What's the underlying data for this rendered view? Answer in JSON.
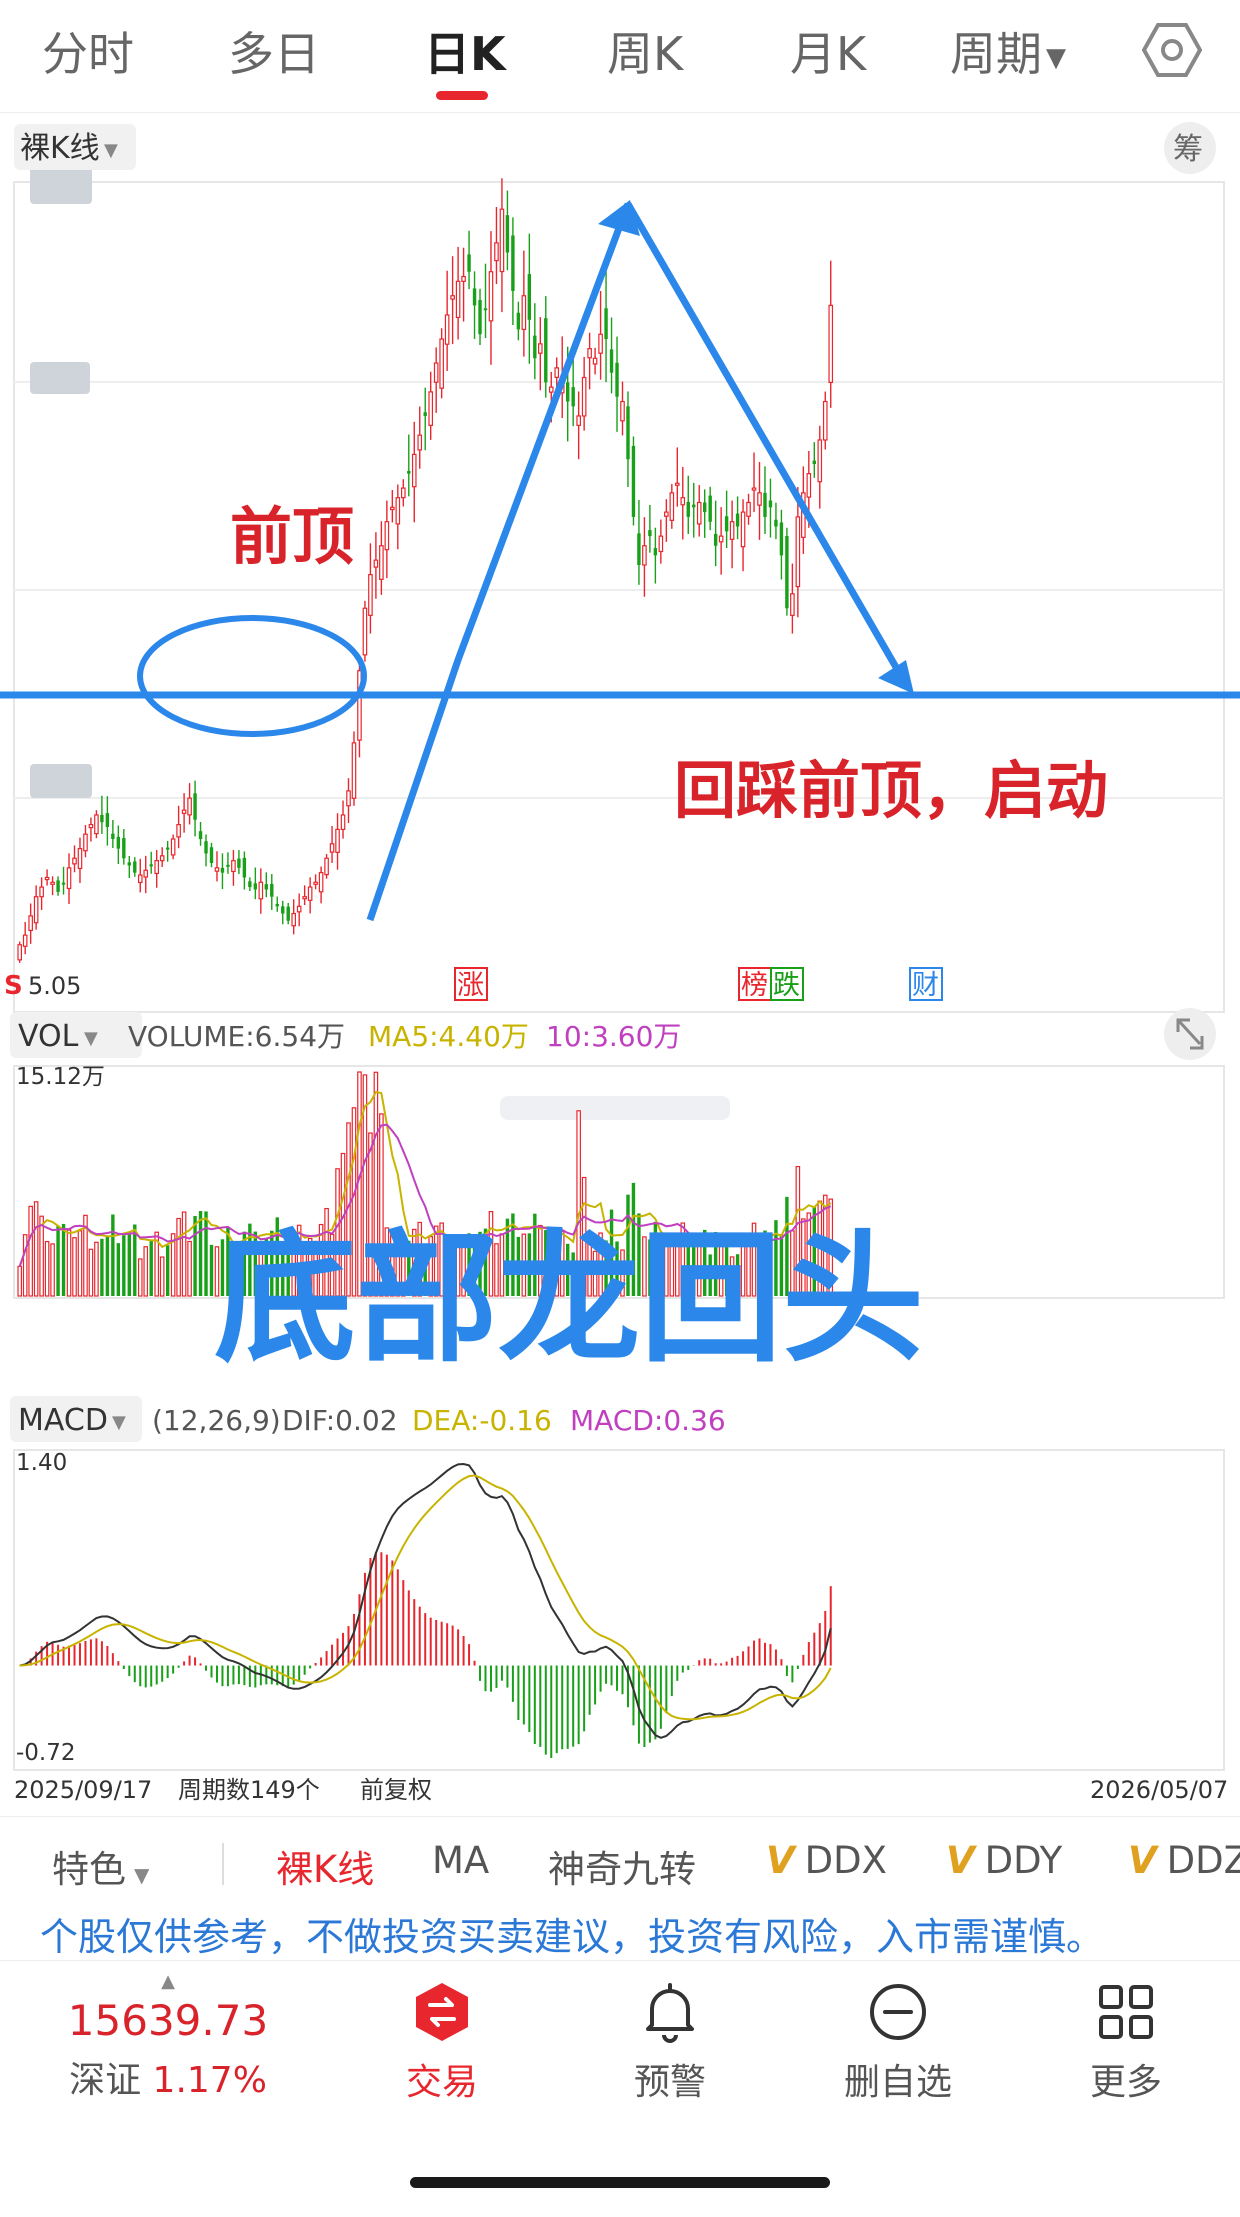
{
  "tabs": [
    "分时",
    "多日",
    "日K",
    "周K",
    "月K",
    "周期"
  ],
  "active_tab": "日K",
  "colors": {
    "up": "#e8262d",
    "down": "#18a018",
    "annotation": "#2b88ea",
    "ma5": "#c8b400",
    "ma10": "#c040c0",
    "dea": "#c8b400",
    "dif": "#333333"
  },
  "kline": {
    "type_label": "裸K线",
    "chip_label": "筹",
    "low_label": "5.05",
    "s_mark": "S",
    "markers": [
      "涨",
      "榜",
      "跌",
      "财"
    ]
  },
  "volume": {
    "indicator": "VOL",
    "volume_text": "VOLUME:6.54万",
    "ma5_text": "MA5:4.40万",
    "ma10_text": "10:3.60万",
    "max_label": "15.12万"
  },
  "macd": {
    "indicator": "MACD",
    "params": "(12,26,9)",
    "dif_text": "DIF:0.02",
    "dea_text": "DEA:-0.16",
    "macd_text": "MACD:0.36",
    "max_label": "1.40",
    "min_label": "-0.72"
  },
  "footer_axis": {
    "start_date": "2025/09/17",
    "period_count": "周期数149个",
    "adjust": "前复权",
    "end_date": "2026/05/07"
  },
  "annotations": {
    "prev_top": "前顶",
    "retest": "回踩前顶，启动",
    "pattern": "底部龙回头"
  },
  "features": [
    "特色",
    "裸K线",
    "MA",
    "神奇九转",
    "DDX",
    "DDY",
    "DDZ"
  ],
  "disclaimer": "个股仅供参考，不做投资买卖建议，投资有风险，入市需谨慎。",
  "index": {
    "value": "15639.73",
    "name": "深证",
    "change": "1.17%"
  },
  "nav": [
    "交易",
    "预警",
    "删自选",
    "更多"
  ],
  "chart_data": {
    "type": "candlestick",
    "count": 149,
    "x_start": "2025/09/17",
    "x_end": "2026/05/07",
    "low_label": 5.05,
    "close": [
      5.3,
      5.5,
      5.9,
      6.3,
      6.5,
      6.7,
      6.6,
      6.4,
      6.55,
      6.9,
      7.1,
      7.3,
      7.6,
      7.8,
      8.0,
      7.85,
      7.75,
      7.5,
      7.3,
      7.1,
      6.95,
      6.8,
      6.75,
      6.85,
      6.95,
      7.05,
      7.15,
      7.3,
      7.5,
      7.8,
      8.1,
      8.35,
      7.9,
      7.5,
      7.2,
      7.0,
      6.9,
      6.8,
      6.95,
      7.05,
      6.9,
      6.7,
      6.5,
      6.45,
      6.6,
      6.45,
      6.3,
      6.1,
      5.95,
      5.8,
      5.95,
      6.1,
      6.3,
      6.5,
      6.6,
      6.8,
      7.1,
      7.4,
      7.7,
      8.0,
      8.5,
      9.5,
      11.0,
      12.3,
      13.0,
      13.3,
      13.6,
      14.1,
      14.4,
      14.6,
      14.8,
      15.1,
      15.5,
      15.9,
      16.3,
      16.8,
      17.4,
      17.9,
      18.4,
      18.8,
      19.1,
      19.2,
      19.3,
      18.6,
      18.0,
      18.5,
      19.3,
      19.9,
      20.6,
      19.7,
      18.9,
      18.1,
      18.8,
      18.3,
      17.5,
      17.8,
      17.0,
      16.9,
      17.3,
      17.1,
      16.6,
      16.5,
      16.3,
      17.1,
      17.7,
      17.5,
      18.0,
      17.9,
      17.2,
      16.7,
      16.6,
      15.4,
      14.2,
      13.2,
      13.6,
      13.8,
      13.4,
      13.8,
      14.3,
      14.7,
      14.9,
      14.6,
      14.2,
      14.4,
      14.5,
      14.3,
      14.1,
      13.6,
      13.8,
      13.9,
      14.1,
      14.0,
      14.3,
      14.5,
      14.8,
      14.7,
      14.2,
      14.4,
      14.0,
      13.4,
      12.3,
      12.6,
      14.2,
      14.7,
      15.1,
      15.3,
      15.8,
      16.6,
      18.6
    ],
    "volume_max": 15.12,
    "volume_last": 6.54,
    "ma5_last": 4.4,
    "ma10_last": 3.6,
    "macd_range": [
      -0.72,
      1.4
    ],
    "dif_last": 0.02,
    "dea_last": -0.16,
    "macd_last": 0.36
  }
}
